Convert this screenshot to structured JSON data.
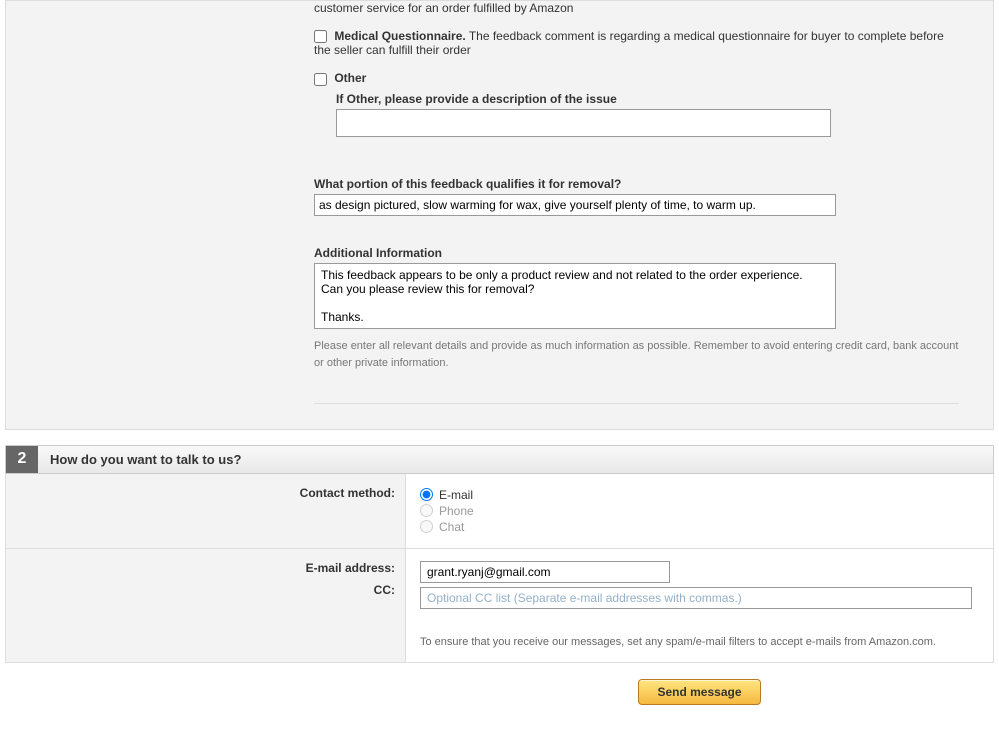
{
  "section1": {
    "fba": {
      "desc": "customer service for an order fulfilled by Amazon"
    },
    "medical": {
      "label": "Medical Questionnaire.",
      "desc": " The feedback comment is regarding a medical questionnaire for buyer to complete before the seller can fulfill their order"
    },
    "other": {
      "label": "Other",
      "sublabel": "If Other, please provide a description of the issue",
      "value": ""
    },
    "qualifies": {
      "label": "What portion of this feedback qualifies it for removal?",
      "value": "as design pictured, slow warming for wax, give yourself plenty of time, to warm up."
    },
    "additional": {
      "label": "Additional Information",
      "value": "This feedback appears to be only a product review and not related to the order experience.  Can you please review this for removal?\n\nThanks.",
      "helper": "Please enter all relevant details and provide as much information as possible. Remember to avoid entering credit card, bank account or other private information."
    }
  },
  "section2": {
    "number": "2",
    "title": "How do you want to talk to us?",
    "contact_method_label": "Contact method:",
    "methods": {
      "email": "E-mail",
      "phone": "Phone",
      "chat": "Chat"
    },
    "email_label": "E-mail address:",
    "email_value": "grant.ryanj@gmail.com",
    "cc_label": "CC:",
    "cc_placeholder": "Optional CC list (Separate e-mail addresses with commas.)",
    "note": "To ensure that you receive our messages, set any spam/e-mail filters to accept e-mails from Amazon.com."
  },
  "send_button": "Send message"
}
